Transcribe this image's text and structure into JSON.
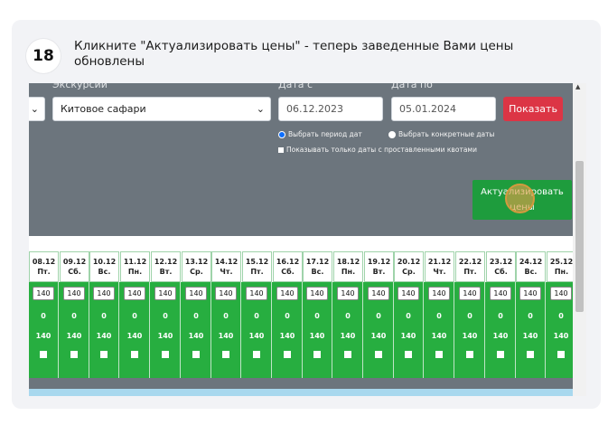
{
  "step": {
    "number": "18",
    "title": "Кликните \"Актуализировать цены\" - теперь заведенные Вами цены обновлены"
  },
  "filters": {
    "excursion_label": "Экскурсии",
    "excursion_value": "Китовое сафари",
    "date_from_label": "Дата с",
    "date_from_value": "06.12.2023",
    "date_to_label": "Дата по",
    "date_to_value": "05.01.2024",
    "show_button": "Показать",
    "radio_period": "Выбрать период дат",
    "radio_specific": "Выбрать конкретные даты",
    "checkbox_quotas": "Показывать только даты с проставленными квотами"
  },
  "actualize_button": {
    "line1": "Актуализировать",
    "line2": "цены"
  },
  "table": {
    "columns": [
      {
        "date": "08.12",
        "day": "Пт."
      },
      {
        "date": "09.12",
        "day": "Сб."
      },
      {
        "date": "10.12",
        "day": "Вс."
      },
      {
        "date": "11.12",
        "day": "Пн."
      },
      {
        "date": "12.12",
        "day": "Вт."
      },
      {
        "date": "13.12",
        "day": "Ср."
      },
      {
        "date": "14.12",
        "day": "Чт."
      },
      {
        "date": "15.12",
        "day": "Пт."
      },
      {
        "date": "16.12",
        "day": "Сб."
      },
      {
        "date": "17.12",
        "day": "Вс."
      },
      {
        "date": "18.12",
        "day": "Пн."
      },
      {
        "date": "19.12",
        "day": "Вт."
      },
      {
        "date": "20.12",
        "day": "Ср."
      },
      {
        "date": "21.12",
        "day": "Чт."
      },
      {
        "date": "22.12",
        "day": "Пт."
      },
      {
        "date": "23.12",
        "day": "Сб."
      },
      {
        "date": "24.12",
        "day": "Вс."
      },
      {
        "date": "25.12",
        "day": "Пн."
      }
    ],
    "price_value": "140",
    "zero_value": "0",
    "total_value": "140"
  },
  "colors": {
    "accent_green": "#27ae40",
    "show_red": "#dc3545",
    "panel_gray": "#6c757d"
  }
}
